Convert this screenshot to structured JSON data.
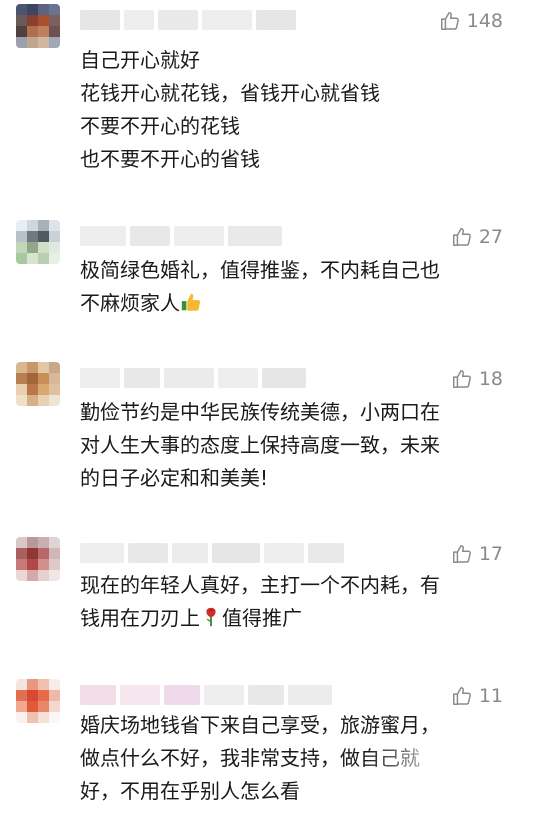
{
  "comments": [
    {
      "likes": "148",
      "lines": [
        "自己开心就好",
        "花钱开心就花钱，省钱开心就省钱",
        "不要不开心的花钱",
        "也不要不开心的省钱"
      ]
    },
    {
      "likes": "27",
      "lines": [
        "极简绿色婚礼，值得推鉴，不内耗自己也",
        "不麻烦家人"
      ],
      "emoji": "thumbs-up-emoji"
    },
    {
      "likes": "18",
      "lines": [
        "勤俭节约是中华民族传统美德，小两口在",
        "对人生大事的态度上保持高度一致，未来",
        "的日子必定和和美美!"
      ]
    },
    {
      "likes": "17",
      "lines": [
        "现在的年轻人真好，主打一个不内耗，有",
        "钱用在刀刃上",
        "值得推广"
      ],
      "emoji": "rose-emoji"
    },
    {
      "likes": "11",
      "lines": [
        "婚庆场地钱省下来自己享受，旅游蜜月，",
        "做点什么不好，我非常支持，做自己就",
        "好，不用在乎别人怎么看"
      ]
    }
  ],
  "icons": {
    "like": "thumbs-up-outline-icon"
  },
  "colors": {
    "like_gray": "#8a8a8a",
    "text": "#1a1a1a"
  }
}
